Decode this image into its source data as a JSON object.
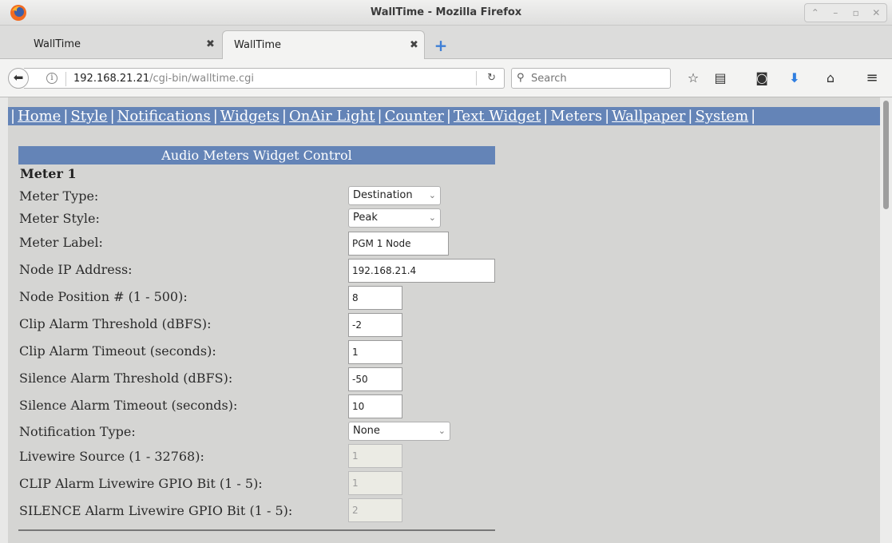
{
  "window": {
    "title": "WallTime - Mozilla Firefox"
  },
  "tabs": [
    {
      "label": "WallTime",
      "close": "✖"
    },
    {
      "label": "WallTime",
      "close": "✖"
    }
  ],
  "navbar": {
    "url_host": "192.168.21.21",
    "url_path": "/cgi-bin/walltime.cgi",
    "search_placeholder": "Search"
  },
  "topnav": {
    "items": [
      "Home",
      "Style",
      "Notifications",
      "Widgets",
      "OnAir Light",
      "Counter",
      "Text Widget",
      "Meters",
      "Wallpaper",
      "System"
    ],
    "separator": "|"
  },
  "widget": {
    "title": "Audio Meters Widget Control",
    "meter_heading": "Meter 1",
    "fields": {
      "meter_type": {
        "label": "Meter Type:",
        "value": "Destination"
      },
      "meter_style": {
        "label": "Meter Style:",
        "value": "Peak"
      },
      "meter_label": {
        "label": "Meter Label:",
        "value": "PGM 1 Node"
      },
      "node_ip": {
        "label": "Node IP Address:",
        "value": "192.168.21.4"
      },
      "node_position": {
        "label": "Node Position # (1 - 500):",
        "value": "8"
      },
      "clip_threshold": {
        "label": "Clip Alarm Threshold (dBFS):",
        "value": "-2"
      },
      "clip_timeout": {
        "label": "Clip Alarm Timeout (seconds):",
        "value": "1"
      },
      "silence_threshold": {
        "label": "Silence Alarm Threshold (dBFS):",
        "value": "-50"
      },
      "silence_timeout": {
        "label": "Silence Alarm Timeout (seconds):",
        "value": "10"
      },
      "notification_type": {
        "label": "Notification Type:",
        "value": "None"
      },
      "livewire_source": {
        "label": "Livewire Source (1 - 32768):",
        "value": "1"
      },
      "clip_gpio": {
        "label": "CLIP Alarm Livewire GPIO Bit (1 - 5):",
        "value": "1"
      },
      "silence_gpio": {
        "label": "SILENCE Alarm Livewire GPIO Bit (1 - 5):",
        "value": "2"
      }
    }
  },
  "icons": {
    "back": "back-arrow-icon",
    "info": "info-icon",
    "reload": "reload-icon",
    "search": "search-icon",
    "bookmark": "star-icon",
    "reading_list": "reading-list-icon",
    "pocket": "pocket-icon",
    "downloads": "download-icon",
    "home": "home-icon",
    "menu": "hamburger-menu-icon"
  },
  "colors": {
    "nav_bar_bg": "#6484b7",
    "page_bg": "#d5d5d3",
    "download_blue": "#2f7ee0"
  }
}
